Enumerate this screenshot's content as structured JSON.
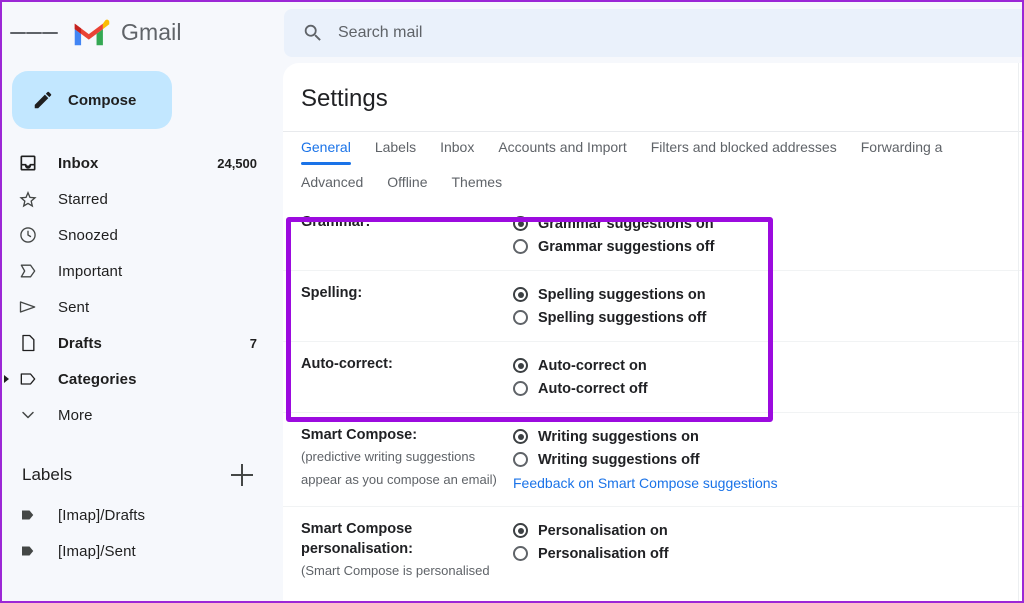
{
  "colors": {
    "accent_blue": "#1a73e8",
    "compose_bg": "#c2e7ff",
    "highlight_purple": "#9c0bdf",
    "search_bg": "#eaf1fb",
    "page_bg": "#f6f8fc"
  },
  "topbar": {
    "menu_icon": "hamburger-icon",
    "brand": "Gmail",
    "logo_icon": "gmail-logo-icon",
    "search": {
      "icon": "search-icon",
      "placeholder": "Search mail",
      "value": ""
    }
  },
  "sidebar": {
    "compose": {
      "label": "Compose",
      "icon": "pencil-icon"
    },
    "items": [
      {
        "label": "Inbox",
        "icon": "inbox-icon",
        "count": "24,500",
        "bold": true,
        "expandable": false
      },
      {
        "label": "Starred",
        "icon": "star-icon",
        "count": "",
        "bold": false,
        "expandable": false
      },
      {
        "label": "Snoozed",
        "icon": "clock-icon",
        "count": "",
        "bold": false,
        "expandable": false
      },
      {
        "label": "Important",
        "icon": "important-icon",
        "count": "",
        "bold": false,
        "expandable": false
      },
      {
        "label": "Sent",
        "icon": "send-icon",
        "count": "",
        "bold": false,
        "expandable": false
      },
      {
        "label": "Drafts",
        "icon": "draft-icon",
        "count": "7",
        "bold": true,
        "expandable": false
      },
      {
        "label": "Categories",
        "icon": "label-icon",
        "count": "",
        "bold": true,
        "expandable": true
      },
      {
        "label": "More",
        "icon": "chevron-down-icon",
        "count": "",
        "bold": false,
        "expandable": false
      }
    ],
    "labels_section": {
      "title": "Labels",
      "add_icon": "plus-icon",
      "items": [
        {
          "label": "[Imap]/Drafts",
          "icon": "label-tag-icon"
        },
        {
          "label": "[Imap]/Sent",
          "icon": "label-tag-icon"
        }
      ]
    }
  },
  "main": {
    "page_title": "Settings",
    "tabs_row1": [
      {
        "label": "General",
        "active": true
      },
      {
        "label": "Labels",
        "active": false
      },
      {
        "label": "Inbox",
        "active": false
      },
      {
        "label": "Accounts and Import",
        "active": false
      },
      {
        "label": "Filters and blocked addresses",
        "active": false
      },
      {
        "label": "Forwarding a",
        "active": false
      }
    ],
    "tabs_row2": [
      {
        "label": "Advanced",
        "active": false
      },
      {
        "label": "Offline",
        "active": false
      },
      {
        "label": "Themes",
        "active": false
      }
    ],
    "settings_rows": [
      {
        "title": "Grammar:",
        "sub_lines": [],
        "options": [
          {
            "label": "Grammar suggestions on",
            "selected": true
          },
          {
            "label": "Grammar suggestions off",
            "selected": false
          }
        ],
        "link": ""
      },
      {
        "title": "Spelling:",
        "sub_lines": [],
        "options": [
          {
            "label": "Spelling suggestions on",
            "selected": true
          },
          {
            "label": "Spelling suggestions off",
            "selected": false
          }
        ],
        "link": ""
      },
      {
        "title": "Auto-correct:",
        "sub_lines": [],
        "options": [
          {
            "label": "Auto-correct on",
            "selected": true
          },
          {
            "label": "Auto-correct off",
            "selected": false
          }
        ],
        "link": ""
      },
      {
        "title": "Smart Compose:",
        "sub_lines": [
          "(predictive writing suggestions",
          "appear as you compose an email)"
        ],
        "options": [
          {
            "label": "Writing suggestions on",
            "selected": true
          },
          {
            "label": "Writing suggestions off",
            "selected": false
          }
        ],
        "link": "Feedback on Smart Compose suggestions"
      },
      {
        "title": "Smart Compose personalisation:",
        "sub_lines": [
          "(Smart Compose is personalised"
        ],
        "options": [
          {
            "label": "Personalisation on",
            "selected": true
          },
          {
            "label": "Personalisation off",
            "selected": false
          }
        ],
        "link": ""
      }
    ]
  }
}
